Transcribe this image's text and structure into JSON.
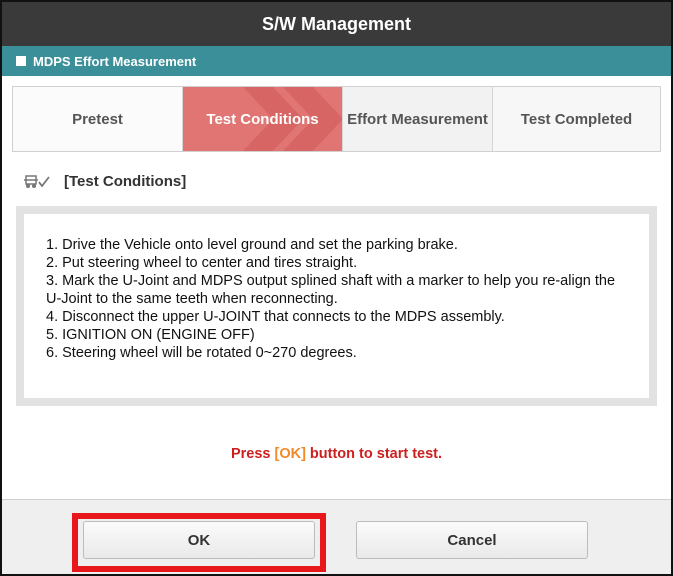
{
  "window": {
    "title": "S/W Management"
  },
  "section": {
    "title": "MDPS Effort Measurement"
  },
  "steps": [
    {
      "label": "Pretest"
    },
    {
      "label": "Test Conditions"
    },
    {
      "label": "Effort Measurement"
    },
    {
      "label": "Test Completed"
    }
  ],
  "conditions": {
    "heading": "[Test Conditions]",
    "lines": [
      "1. Drive the Vehicle onto level ground and set the parking brake.",
      "2. Put steering wheel to center and tires straight.",
      "3. Mark the U-Joint and MDPS output splined shaft with a marker to help you re-align the U-Joint to the same teeth when reconnecting.",
      "4. Disconnect the upper U-JOINT that connects to the MDPS assembly.",
      "5. IGNITION ON (ENGINE OFF)",
      "6. Steering wheel will be rotated 0~270 degrees."
    ]
  },
  "prompt": {
    "before": "Press ",
    "key": "[OK]",
    "after": " button to start test."
  },
  "buttons": {
    "ok": "OK",
    "cancel": "Cancel"
  },
  "colors": {
    "active_step": "#e07573",
    "section_bar": "#3a8f98",
    "highlight": "#e8171b"
  },
  "icons": {
    "conditions": "vehicle-checklist-icon"
  },
  "active_step_index": 1
}
